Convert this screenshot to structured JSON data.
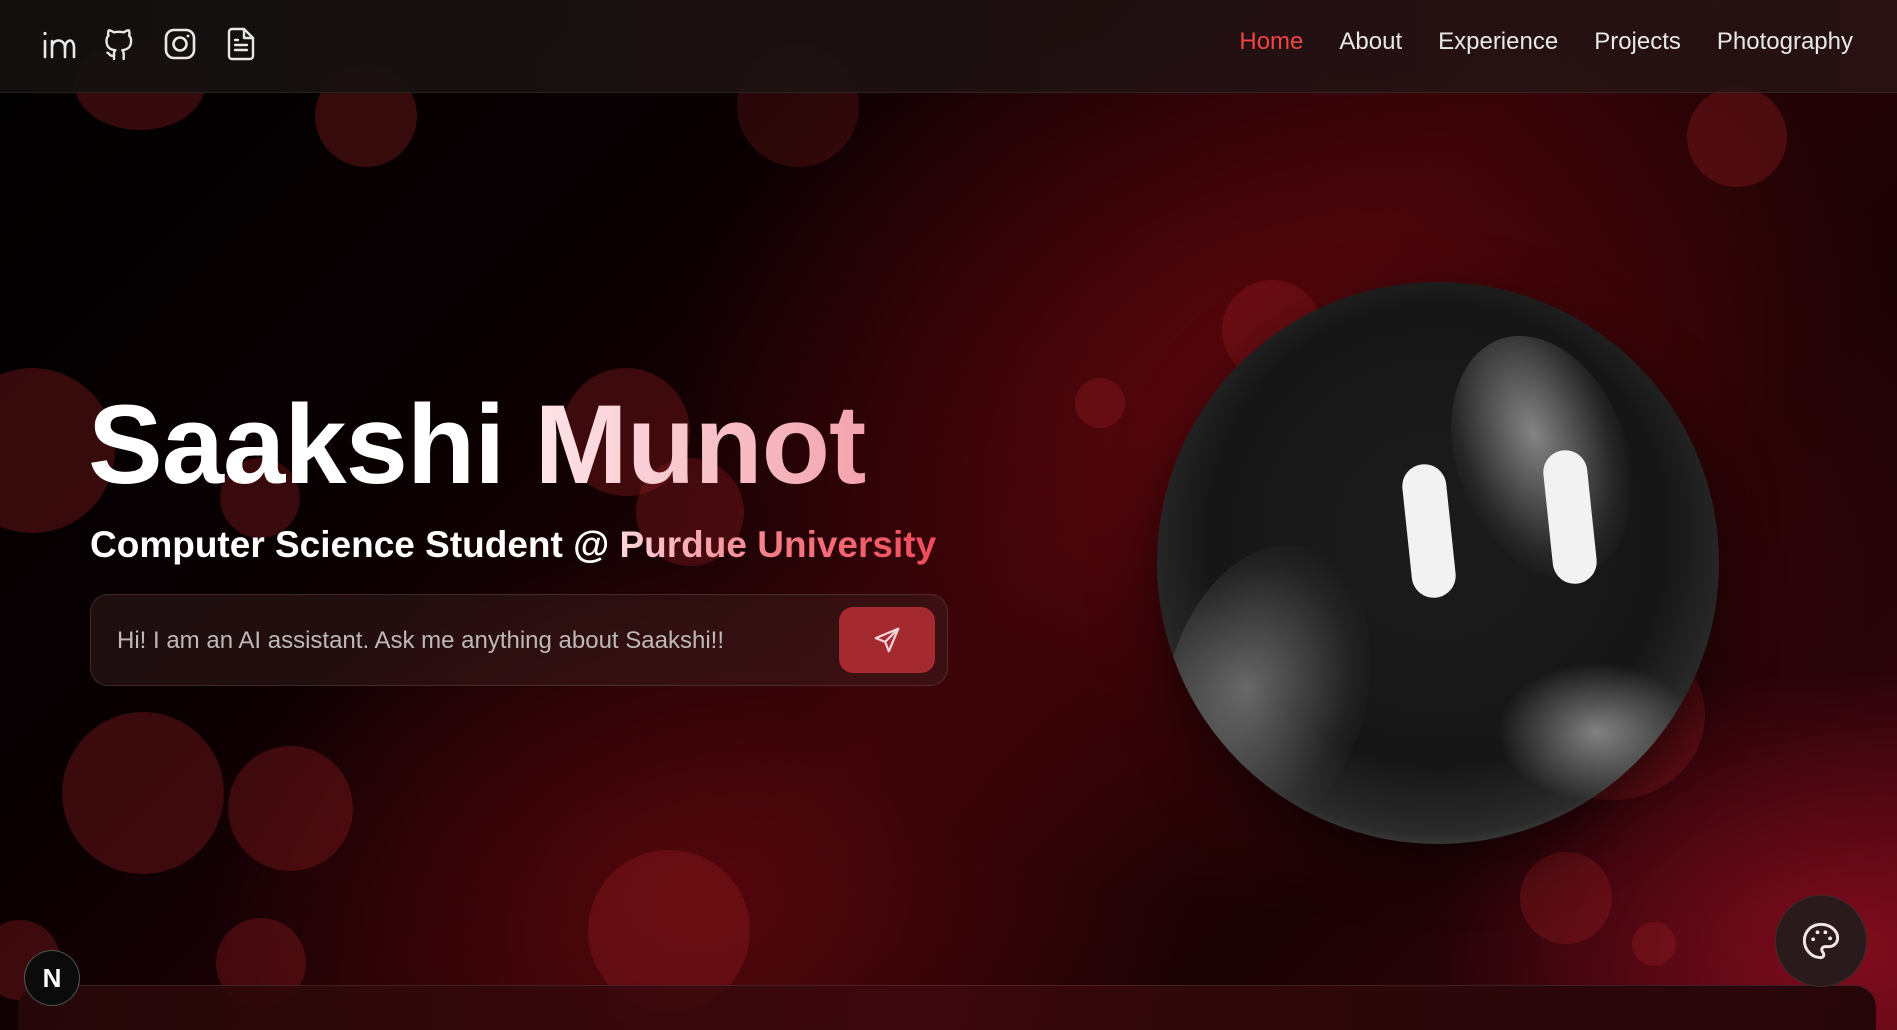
{
  "header": {
    "social_icons": [
      "linkedin-icon",
      "github-icon",
      "instagram-icon",
      "resume-document-icon"
    ],
    "nav": [
      {
        "label": "Home",
        "active": true
      },
      {
        "label": "About",
        "active": false
      },
      {
        "label": "Experience",
        "active": false
      },
      {
        "label": "Projects",
        "active": false
      },
      {
        "label": "Photography",
        "active": false
      }
    ]
  },
  "hero": {
    "first_name": "Saakshi",
    "last_name": "Munot",
    "subtitle_prefix": "Computer Science Student @",
    "subtitle_school_a": "Purdue",
    "subtitle_school_b": "University",
    "chat": {
      "placeholder": "Hi! I am an AI assistant. Ask me anything about Saakshi!!",
      "send_icon": "send-icon"
    }
  },
  "floating": {
    "palette_icon": "palette-icon",
    "badge_letter": "N"
  },
  "colors": {
    "accent": "#ef4444",
    "send_button": "#a52a2f",
    "background_dark": "#000000",
    "background_red": "#8c0a14"
  }
}
